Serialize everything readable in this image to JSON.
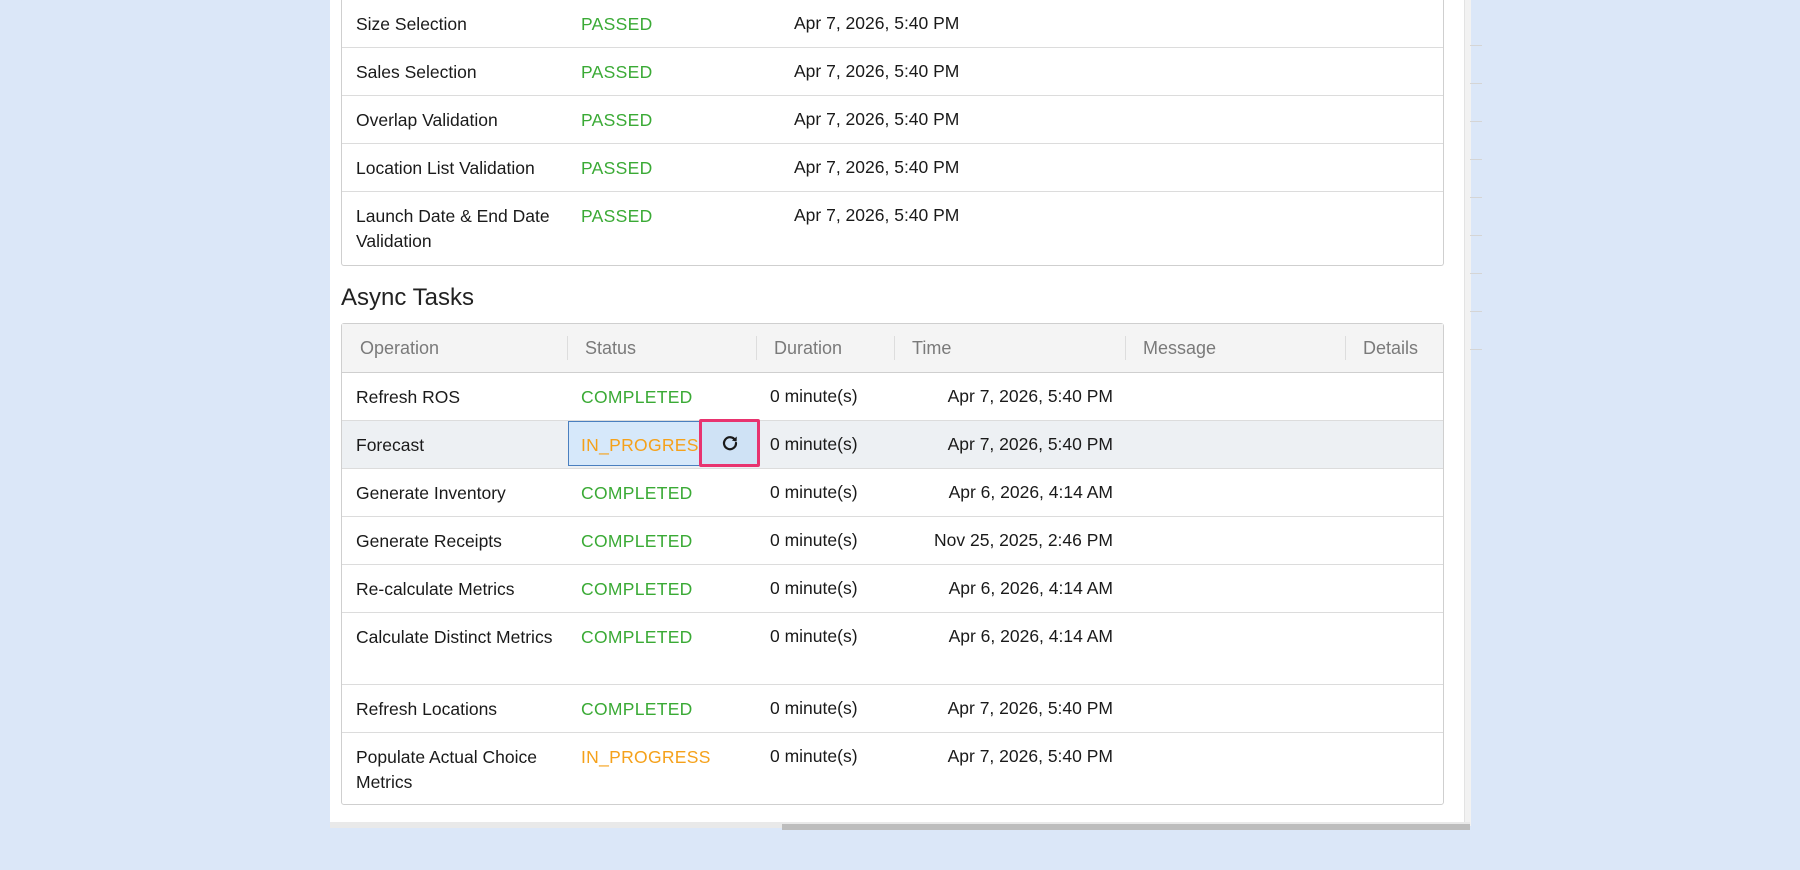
{
  "validations": [
    {
      "name": "Size Selection",
      "status": "PASSED",
      "time": "Apr 7, 2026, 5:40 PM"
    },
    {
      "name": "Sales Selection",
      "status": "PASSED",
      "time": "Apr 7, 2026, 5:40 PM"
    },
    {
      "name": "Overlap Validation",
      "status": "PASSED",
      "time": "Apr 7, 2026, 5:40 PM"
    },
    {
      "name": "Location List Validation",
      "status": "PASSED",
      "time": "Apr 7, 2026, 5:40 PM"
    },
    {
      "name": "Launch Date & End Date Validation",
      "status": "PASSED",
      "time": "Apr 7, 2026, 5:40 PM"
    }
  ],
  "async": {
    "title": "Async Tasks",
    "columns": [
      "Operation",
      "Status",
      "Duration",
      "Time",
      "Message",
      "Details"
    ],
    "rows": [
      {
        "operation": "Refresh ROS",
        "status": "COMPLETED",
        "duration": "0 minute(s)",
        "time": "Apr 7, 2026, 5:40 PM"
      },
      {
        "operation": "Forecast",
        "status": "IN_PROGRESS",
        "duration": "0 minute(s)",
        "time": "Apr 7, 2026, 5:40 PM"
      },
      {
        "operation": "Generate Inventory",
        "status": "COMPLETED",
        "duration": "0 minute(s)",
        "time": "Apr 6, 2026, 4:14 AM"
      },
      {
        "operation": "Generate Receipts",
        "status": "COMPLETED",
        "duration": "0 minute(s)",
        "time": "Nov 25, 2025, 2:46 PM"
      },
      {
        "operation": "Re-calculate Metrics",
        "status": "COMPLETED",
        "duration": "0 minute(s)",
        "time": "Apr 6, 2026, 4:14 AM"
      },
      {
        "operation": "Calculate Distinct Metrics",
        "status": "COMPLETED",
        "duration": "0 minute(s)",
        "time": "Apr 6, 2026, 4:14 AM"
      },
      {
        "operation": "Refresh Locations",
        "status": "COMPLETED",
        "duration": "0 minute(s)",
        "time": "Apr 7, 2026, 5:40 PM"
      },
      {
        "operation": "Populate Actual Choice Metrics",
        "status": "IN_PROGRESS",
        "duration": "0 minute(s)",
        "time": "Apr 7, 2026, 5:40 PM"
      }
    ]
  },
  "icons": {
    "refresh": "refresh-icon"
  },
  "colors": {
    "passed": "#3aaa35",
    "completed": "#3aaa35",
    "in_progress": "#f5a11a",
    "highlight": "#e8336f",
    "background": "#dbe7f8"
  }
}
